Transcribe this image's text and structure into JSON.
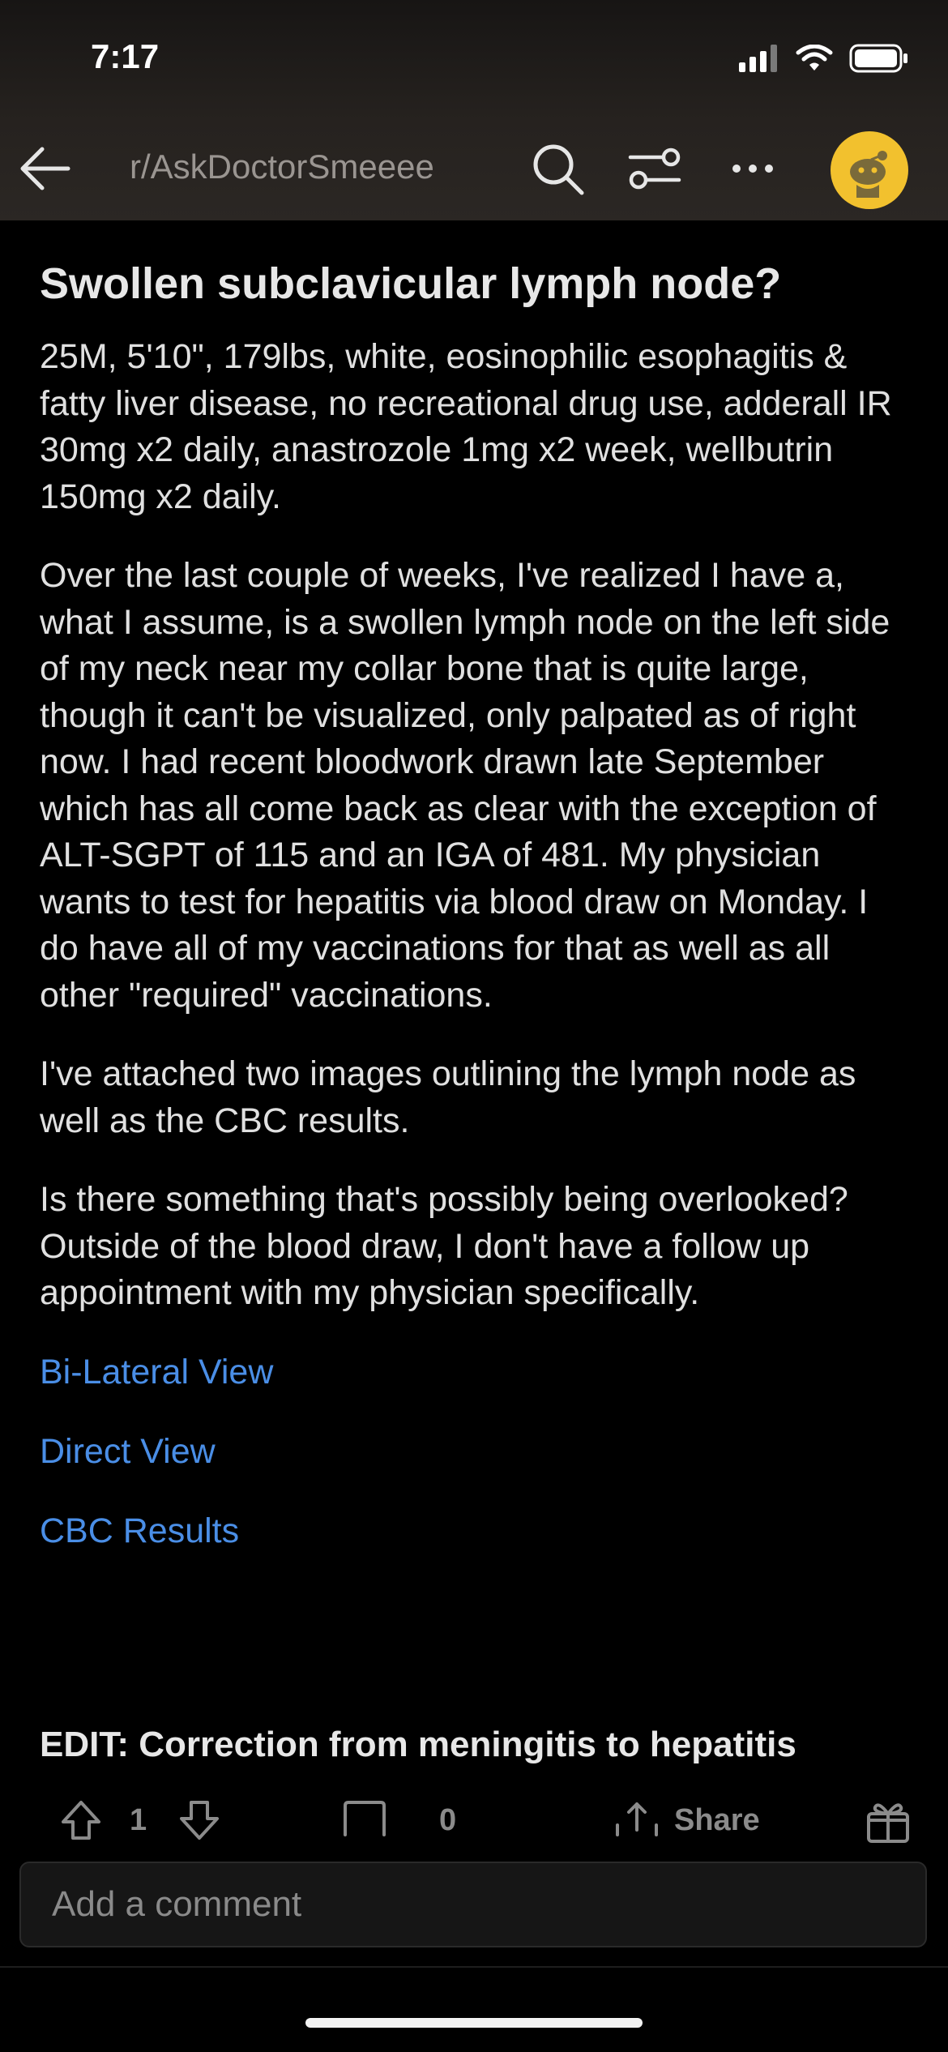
{
  "status_bar": {
    "time": "7:17"
  },
  "nav": {
    "back_icon": "arrow-left-icon",
    "subreddit": "r/AskDoctorSmeeee",
    "search_icon": "search-icon",
    "filter_icon": "sliders-icon",
    "more_icon": "more-horizontal-icon",
    "avatar_icon": "snoo-avatar"
  },
  "post": {
    "title": "Swollen subclavicular lymph node?",
    "paragraphs": [
      "25M, 5'10\", 179lbs, white, eosinophilic esophagitis & fatty liver disease, no recreational drug use, adderall IR 30mg x2 daily, anastrozole 1mg x2 week, wellbutrin 150mg x2 daily.",
      "Over the last couple of weeks, I've realized I have a, what I assume, is a swollen lymph node on the left side of my neck near my collar bone that is quite large, though it can't be visualized, only palpated as of right now. I had recent bloodwork drawn late September which has all come back as clear with the exception of ALT-SGPT of 115 and an IGA of 481. My physician wants to test for hepatitis via blood draw on Monday. I do have all of my vaccinations for that as well as all other \"required\" vaccinations.",
      "I've attached two images outlining the lymph node as well as the CBC results.",
      "Is there something that's possibly being overlooked? Outside of the blood draw, I don't have a follow up appointment with my physician specifically."
    ],
    "links": [
      "Bi-Lateral View",
      "Direct View",
      "CBC Results"
    ],
    "edit": "EDIT: Correction from meningitis to hepatitis"
  },
  "actions": {
    "upvote_icon": "upvote-arrow-icon",
    "score": "1",
    "downvote_icon": "downvote-arrow-icon",
    "comment_icon": "comment-bubble-icon",
    "comment_count": "0",
    "share_icon": "share-icon",
    "share_label": "Share",
    "award_icon": "award-gift-icon"
  },
  "comment_input": {
    "placeholder": "Add a comment"
  },
  "colors": {
    "link": "#4a8ee6",
    "avatar_bg": "#f2c12e",
    "background": "#000000"
  }
}
